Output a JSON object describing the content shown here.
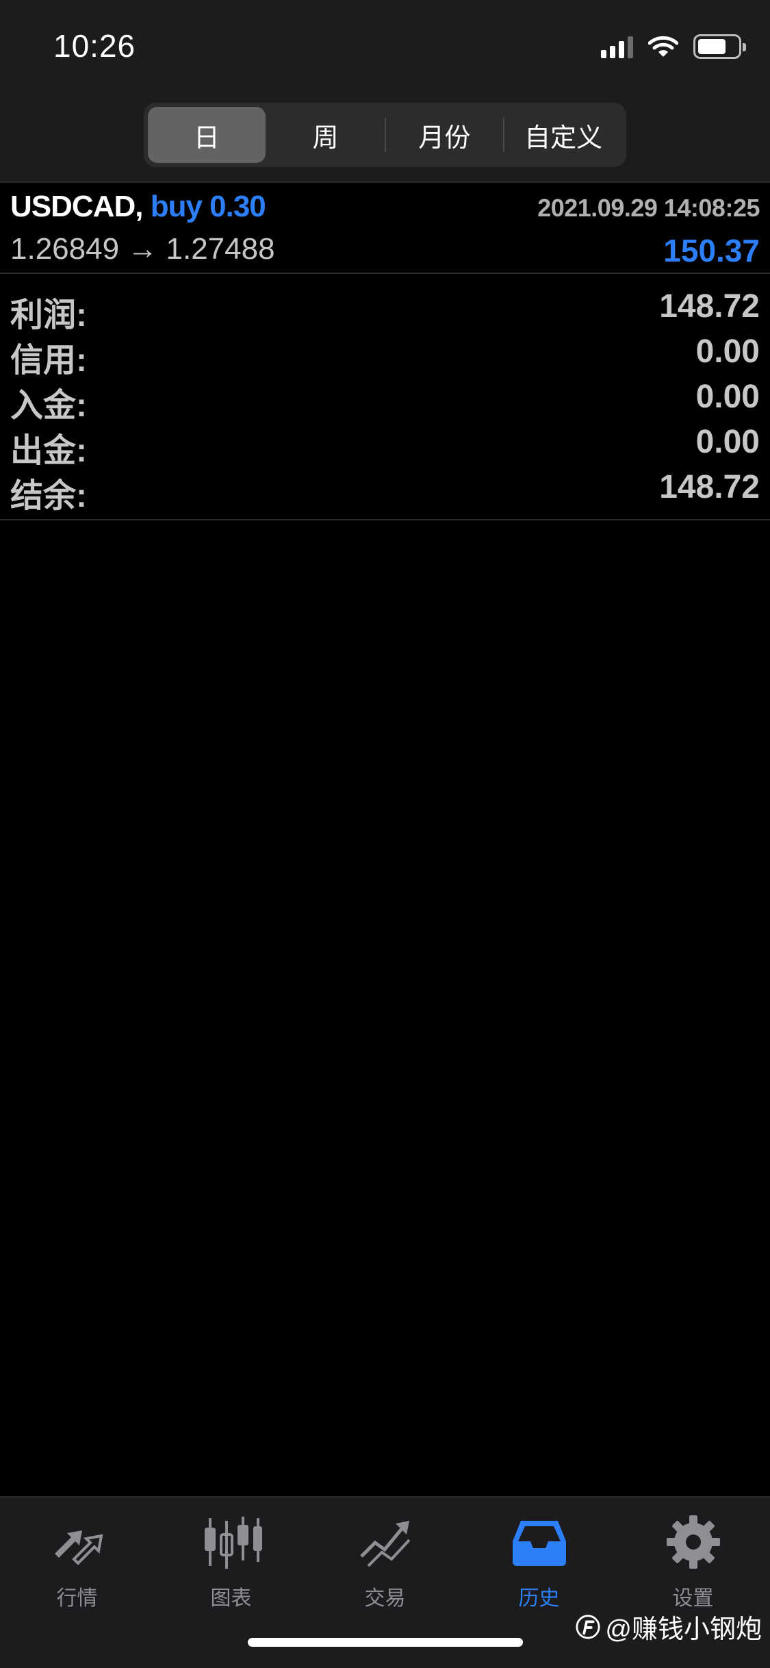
{
  "status": {
    "time": "10:26"
  },
  "tabs": [
    {
      "label": "日",
      "active": true
    },
    {
      "label": "周",
      "active": false
    },
    {
      "label": "月份",
      "active": false
    },
    {
      "label": "自定义",
      "active": false
    }
  ],
  "deal": {
    "symbol": "USDCAD,",
    "side": "buy 0.30",
    "datetime": "2021.09.29 14:08:25",
    "prices": "1.26849 → 1.27488",
    "profit": "150.37"
  },
  "summary": [
    {
      "label": "利润:",
      "value": "148.72"
    },
    {
      "label": "信用:",
      "value": "0.00"
    },
    {
      "label": "入金:",
      "value": "0.00"
    },
    {
      "label": "出金:",
      "value": "0.00"
    },
    {
      "label": "结余:",
      "value": "148.72"
    }
  ],
  "nav": [
    {
      "label": "行情",
      "icon": "quotes-icon",
      "active": false
    },
    {
      "label": "图表",
      "icon": "candlestick-chart-icon",
      "active": false
    },
    {
      "label": "交易",
      "icon": "trade-icon",
      "active": false
    },
    {
      "label": "历史",
      "icon": "history-inbox-icon",
      "active": true
    },
    {
      "label": "设置",
      "icon": "gear-icon",
      "active": false
    }
  ],
  "watermark": "@赚钱小钢炮",
  "colors": {
    "accent": "#2d7ff9",
    "background": "#000000",
    "bar": "#1c1c1e"
  }
}
